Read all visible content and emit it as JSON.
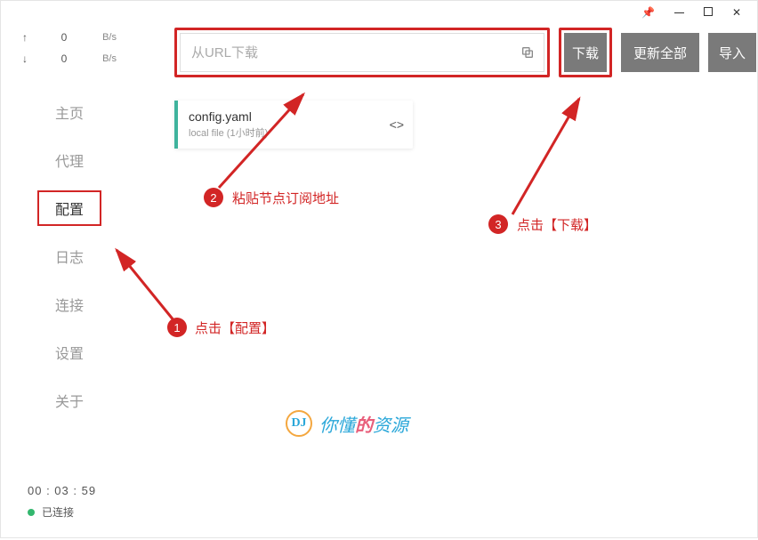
{
  "titlebar": {
    "pin": "📌"
  },
  "sidebar": {
    "traffic": {
      "up": {
        "arrow": "↑",
        "value": "0",
        "unit": "B/s"
      },
      "down": {
        "arrow": "↓",
        "value": "0",
        "unit": "B/s"
      }
    },
    "nav": [
      {
        "label": "主页",
        "active": false
      },
      {
        "label": "代理",
        "active": false
      },
      {
        "label": "配置",
        "active": true
      },
      {
        "label": "日志",
        "active": false
      },
      {
        "label": "连接",
        "active": false
      },
      {
        "label": "设置",
        "active": false
      },
      {
        "label": "关于",
        "active": false
      }
    ],
    "timer": "00 : 03 : 59",
    "status": "已连接"
  },
  "main": {
    "url": {
      "placeholder": "从URL下载"
    },
    "buttons": {
      "download": "下载",
      "update_all": "更新全部",
      "import": "导入"
    },
    "card": {
      "title": "config.yaml",
      "sub": "local file (1小时前)",
      "action": "<>"
    }
  },
  "annotations": {
    "step1": {
      "num": "1",
      "text": "点击【配置】"
    },
    "step2": {
      "num": "2",
      "text": "粘贴节点订阅地址"
    },
    "step3": {
      "num": "3",
      "text": "点击【下载】"
    }
  },
  "watermark": {
    "icon": "DJ",
    "text_prefix": "你懂",
    "text_highlight": "的",
    "text_suffix": "资源"
  }
}
